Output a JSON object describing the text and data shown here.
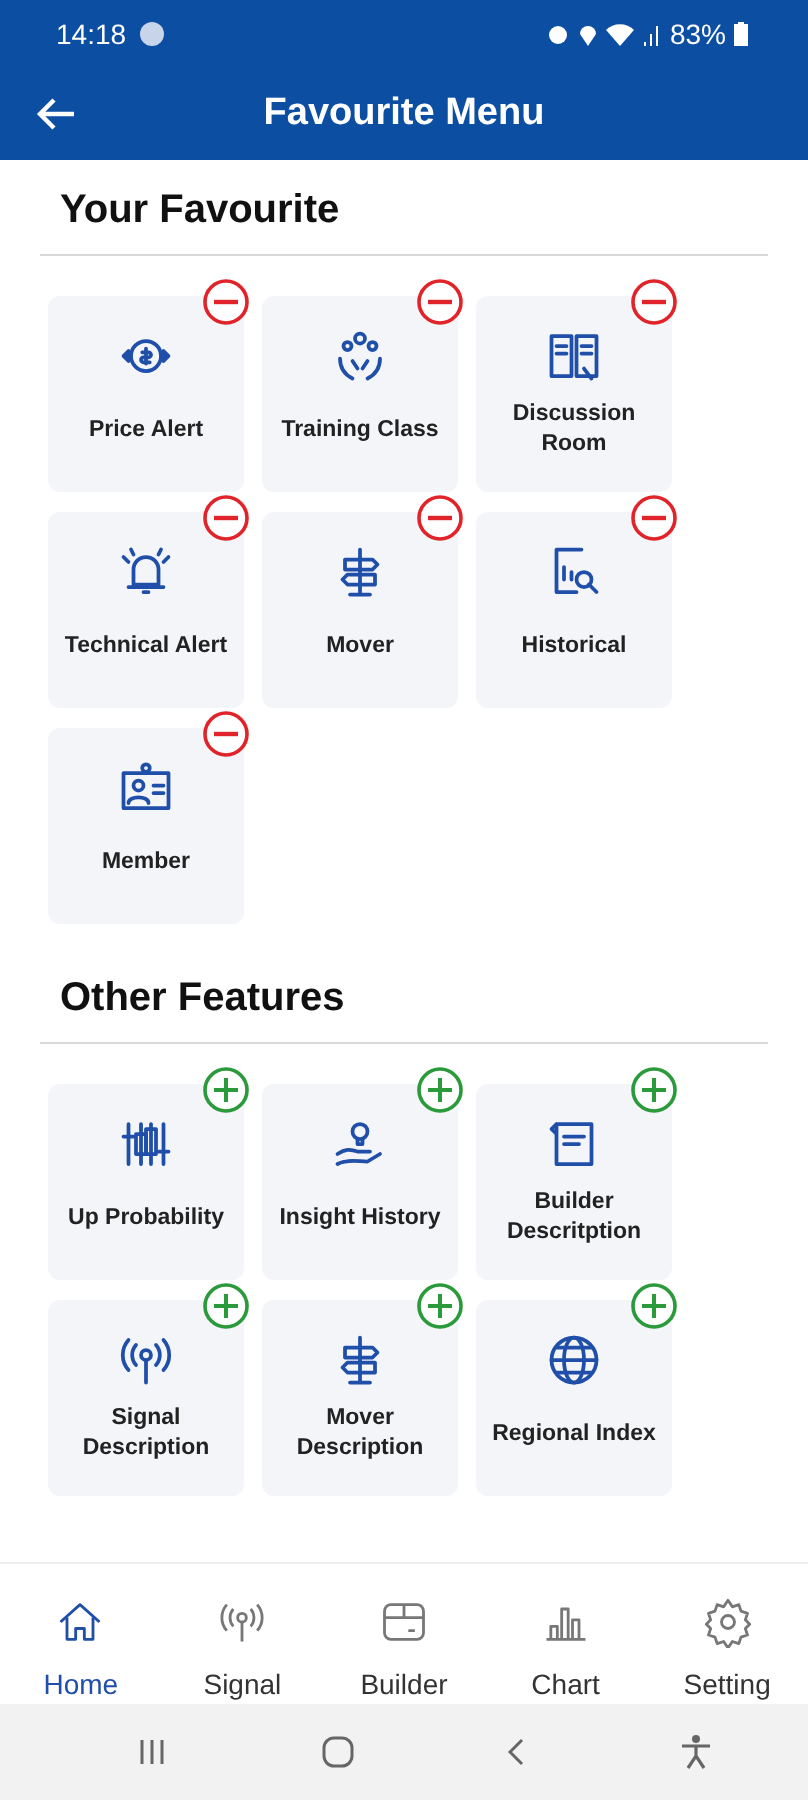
{
  "status_bar": {
    "time": "14:18",
    "battery": "83%"
  },
  "app_bar": {
    "title": "Favourite Menu"
  },
  "sections": [
    {
      "title": "Your Favourite",
      "kind": "removable",
      "items": [
        {
          "label": "Price Alert"
        },
        {
          "label": "Training Class"
        },
        {
          "label": "Discussion Room"
        },
        {
          "label": "Technical Alert"
        },
        {
          "label": "Mover"
        },
        {
          "label": "Historical"
        },
        {
          "label": "Member"
        }
      ]
    },
    {
      "title": "Other Features",
      "kind": "addable",
      "items": [
        {
          "label": "Up Probability"
        },
        {
          "label": "Insight History"
        },
        {
          "label": "Builder Descritption"
        },
        {
          "label": "Signal Description"
        },
        {
          "label": "Mover Description"
        },
        {
          "label": "Regional Index"
        }
      ]
    }
  ],
  "bottom_nav": [
    {
      "label": "Home",
      "selected": true
    },
    {
      "label": "Signal",
      "selected": false
    },
    {
      "label": "Builder",
      "selected": false
    },
    {
      "label": "Chart",
      "selected": false
    },
    {
      "label": "Setting",
      "selected": false
    }
  ]
}
